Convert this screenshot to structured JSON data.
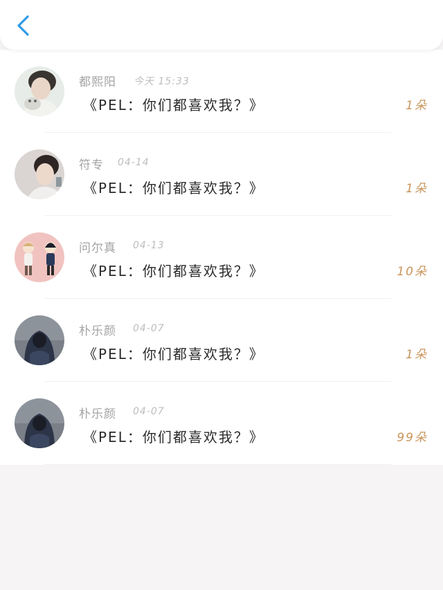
{
  "header": {
    "back_icon": "chevron-left-icon",
    "accent_color": "#2f9be6"
  },
  "messages": [
    {
      "name": "都熙阳",
      "time": "今天 15:33",
      "title": "《PEL：你们都喜欢我？》",
      "count": "1朵",
      "avatar": "avatar-photo-man-with-cat"
    },
    {
      "name": "符专",
      "time": "04-14",
      "title": "《PEL：你们都喜欢我？》",
      "count": "1朵",
      "avatar": "avatar-photo-man"
    },
    {
      "name": "问尔真",
      "time": "04-13",
      "title": "《PEL：你们都喜欢我？》",
      "count": "10朵",
      "avatar": "avatar-cartoon-two-boys"
    },
    {
      "name": "朴乐颜",
      "time": "04-07",
      "title": "《PEL：你们都喜欢我？》",
      "count": "1朵",
      "avatar": "avatar-hooded-figure"
    },
    {
      "name": "朴乐颜",
      "time": "04-07",
      "title": "《PEL：你们都喜欢我？》",
      "count": "99朵",
      "avatar": "avatar-hooded-figure"
    }
  ]
}
